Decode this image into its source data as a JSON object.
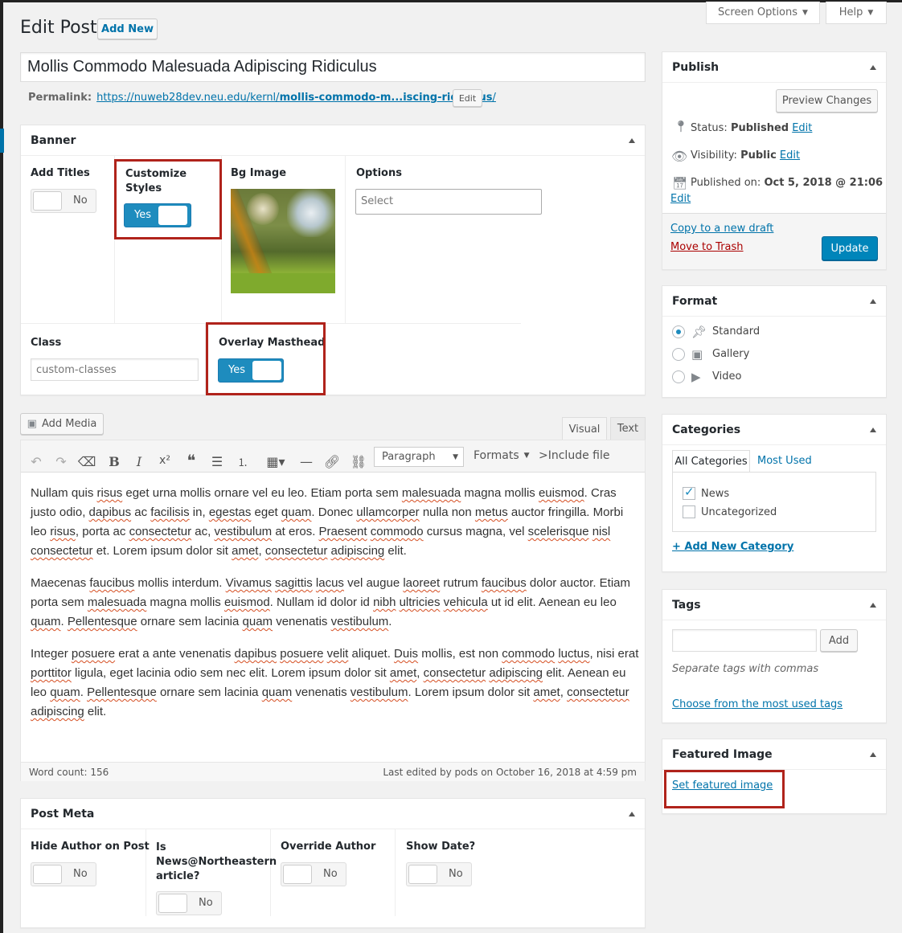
{
  "header": {
    "title": "Edit Post",
    "add_new": "Add New",
    "screen_options": "Screen Options",
    "help": "Help"
  },
  "post": {
    "title": "Mollis Commodo Malesuada Adipiscing Ridiculus",
    "permalink_label": "Permalink:",
    "permalink_base": "https://nuweb28dev.neu.edu/kernl/",
    "permalink_slug": "mollis-commodo-m...iscing-ridiculus",
    "permalink_slash": "/",
    "permalink_edit": "Edit"
  },
  "banner": {
    "title": "Banner",
    "add_titles": "Add Titles",
    "add_titles_toggle": "No",
    "customize_styles_1": "Customize",
    "customize_styles_2": "Styles",
    "customize_styles_toggle": "Yes",
    "bg_image": "Bg Image",
    "options": "Options",
    "options_select": "Select",
    "class": "Class",
    "class_placeholder": "custom-classes",
    "overlay_masthead": "Overlay Masthead",
    "overlay_masthead_toggle": "Yes"
  },
  "editor": {
    "add_media": "Add Media",
    "tab_visual": "Visual",
    "tab_text": "Text",
    "paragraph": "Paragraph",
    "formats": "Formats",
    "include_file": ">Include file",
    "word_count": "Word count: 156",
    "last_edited": "Last edited by pods on October 16, 2018 at 4:59 pm",
    "icons": [
      "undo-icon",
      "redo-icon",
      "eraser-icon",
      "bold-icon",
      "italic-icon",
      "superscript-icon",
      "blockquote-icon",
      "bullet-list-icon",
      "numbered-list-icon",
      "table-icon",
      "horizontal-rule-icon",
      "link-icon",
      "unlink-icon"
    ]
  },
  "post_meta": {
    "title": "Post Meta",
    "hide_author": "Hide Author on Post",
    "hide_author_toggle": "No",
    "is_news_1": "Is",
    "is_news_2": "News@Northeastern",
    "is_news_3": "article?",
    "is_news_toggle": "No",
    "override_author": "Override Author",
    "override_author_toggle": "No",
    "show_date": "Show Date?",
    "show_date_toggle": "No"
  },
  "publish": {
    "title": "Publish",
    "preview_changes": "Preview Changes",
    "status_label": "Status:",
    "status_value": "Published",
    "status_edit": "Edit",
    "visibility_label": "Visibility:",
    "visibility_value": "Public",
    "visibility_edit": "Edit",
    "published_label": "Published on:",
    "published_value": "Oct 5, 2018 @ 21:06",
    "published_edit": "Edit",
    "copy_draft": "Copy to a new draft",
    "move_trash": "Move to Trash",
    "update": "Update"
  },
  "format": {
    "title": "Format",
    "options": [
      "Standard",
      "Gallery",
      "Video"
    ],
    "selected": "Standard"
  },
  "categories": {
    "title": "Categories",
    "tab_all": "All Categories",
    "tab_most_used": "Most Used",
    "items": [
      {
        "label": "News",
        "checked": true
      },
      {
        "label": "Uncategorized",
        "checked": false
      }
    ],
    "add_new": "+ Add New Category"
  },
  "tags": {
    "title": "Tags",
    "add": "Add",
    "hint": "Separate tags with commas",
    "choose": "Choose from the most used tags"
  },
  "featured_image": {
    "title": "Featured Image",
    "set": "Set featured image"
  },
  "colors": {
    "accent": "#0085ba",
    "link": "#0073aa",
    "highlight_border": "#b0231b",
    "trash": "#a00",
    "toggle_on": "#1e8cbe"
  }
}
